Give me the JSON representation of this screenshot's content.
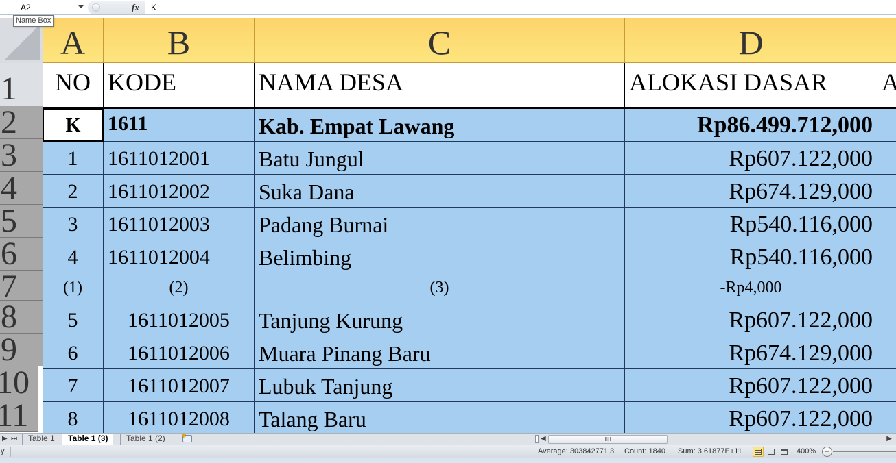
{
  "formula_bar": {
    "name_box": "A2",
    "fx_label": "fx",
    "formula": "K",
    "tooltip": "Name Box"
  },
  "columns": [
    {
      "letter": "A"
    },
    {
      "letter": "B"
    },
    {
      "letter": "C"
    },
    {
      "letter": "D"
    },
    {
      "letter": ""
    }
  ],
  "row_numbers": [
    "1",
    "2",
    "3",
    "4",
    "5",
    "6",
    "7",
    "8",
    "9",
    "10",
    "11"
  ],
  "header_row": {
    "no": "NO",
    "kode": "KODE",
    "nama_desa": "NAMA DESA",
    "alokasi_dasar": "ALOKASI DASAR",
    "next_col": "A"
  },
  "summary_row": {
    "no": "K",
    "kode": "1611",
    "nama": "Kab.  Empat  Lawang",
    "alokasi": "Rp86.499.712,000"
  },
  "rows": [
    {
      "no": "1",
      "kode": "1611012001",
      "nama": "Batu Jungul",
      "alokasi": "Rp607.122,000"
    },
    {
      "no": "2",
      "kode": "1611012002",
      "nama": "Suka  Dana",
      "alokasi": "Rp674.129,000"
    },
    {
      "no": "3",
      "kode": "1611012003",
      "nama": "Padang  Burnai",
      "alokasi": "Rp540.116,000"
    },
    {
      "no": "4",
      "kode": "1611012004",
      "nama": "Belimbing",
      "alokasi": "Rp540.116,000"
    },
    {
      "no": "(1)",
      "kode": "(2)",
      "nama": "(3)",
      "alokasi": "-Rp4,000"
    },
    {
      "no": "5",
      "kode": "1611012005",
      "nama": "Tanjung  Kurung",
      "alokasi": "Rp607.122,000"
    },
    {
      "no": "6",
      "kode": "1611012006",
      "nama": "Muara  Pinang  Baru",
      "alokasi": "Rp674.129,000"
    },
    {
      "no": "7",
      "kode": "1611012007",
      "nama": "Lubuk Tanjung",
      "alokasi": "Rp607.122,000"
    },
    {
      "no": "8",
      "kode": "1611012008",
      "nama": "Talang  Baru",
      "alokasi": "Rp607.122,000"
    }
  ],
  "sheet_tabs": [
    {
      "label": "Table 1",
      "active": false
    },
    {
      "label": "Table 1 (3)",
      "active": true
    },
    {
      "label": "Table 1 (2)",
      "active": false
    }
  ],
  "status_bar": {
    "mode": "y",
    "average": "Average: 303842771,3",
    "count": "Count: 1840",
    "sum": "Sum: 3,61877E+11",
    "zoom": "400%"
  },
  "icons": {
    "nav_next": "▶",
    "nav_last": "⏭",
    "scroll_left": "◀",
    "scroll_right": "▶",
    "scroll_grip": "IIII",
    "zoom_minus": "−",
    "new_sheet_star": "✱"
  }
}
